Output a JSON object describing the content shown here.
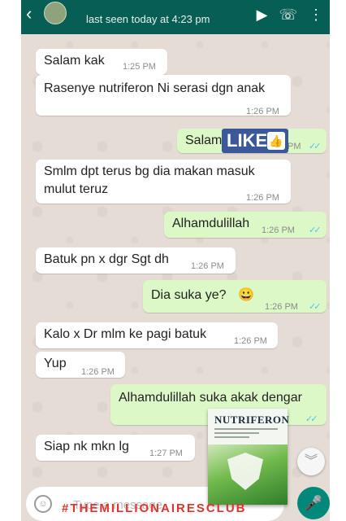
{
  "header": {
    "last_seen": "last seen today at 4:23 pm",
    "back_icon": "arrow-back-icon",
    "icons": [
      "videocam-icon",
      "phone-icon",
      "more-vert-icon"
    ]
  },
  "messages": [
    {
      "dir": "in",
      "text": "Salam kak",
      "time": "1:25 PM"
    },
    {
      "dir": "in",
      "text": "Rasenye nutriferon Ni serasi dgn anak",
      "time": "1:26 PM"
    },
    {
      "dir": "out",
      "text": "Salam",
      "time": "PM",
      "ticks": "✓✓"
    },
    {
      "dir": "in",
      "text_lines": [
        "Smlm dpt terus bg dia makan masuk",
        "mulut teruz"
      ],
      "time": "1:26 PM"
    },
    {
      "dir": "out",
      "text": "Alhamdulillah",
      "time": "1:26 PM",
      "ticks": "✓✓"
    },
    {
      "dir": "in",
      "text": "Batuk pn x dgr Sgt dh",
      "time": "1:26 PM"
    },
    {
      "dir": "out",
      "text": "Dia suka ye?",
      "emoji": "😀",
      "time": "1:26 PM",
      "ticks": "✓✓"
    },
    {
      "dir": "in",
      "text": "Kalo x Dr mlm ke pagi batuk",
      "time": "1:26 PM"
    },
    {
      "dir": "in",
      "text": "Yup",
      "time": "1:26 PM"
    },
    {
      "dir": "out",
      "text": "Alhamdulillah suka akak dengar",
      "time": "PM",
      "ticks": "✓✓"
    },
    {
      "dir": "in",
      "text": "Siap nk mkn lg",
      "time": "1:27 PM"
    }
  ],
  "overlay": {
    "like_label": "LIKE",
    "thumb_icon": "thumbs-up-icon",
    "product_brand": "NUTRIFERON",
    "watermark": "#THEMILLIONAIRESCLUB"
  },
  "input": {
    "placeholder": "Type a message"
  },
  "colors": {
    "header": "#075e54",
    "outgoing_bubble": "#dcf8c6",
    "incoming_bubble": "#ffffff",
    "chat_background": "#e5ddd5",
    "read_ticks": "#4fc3f7",
    "mic_button": "#00897b",
    "watermark": "#e0332f",
    "like_badge": "#3b5998"
  }
}
